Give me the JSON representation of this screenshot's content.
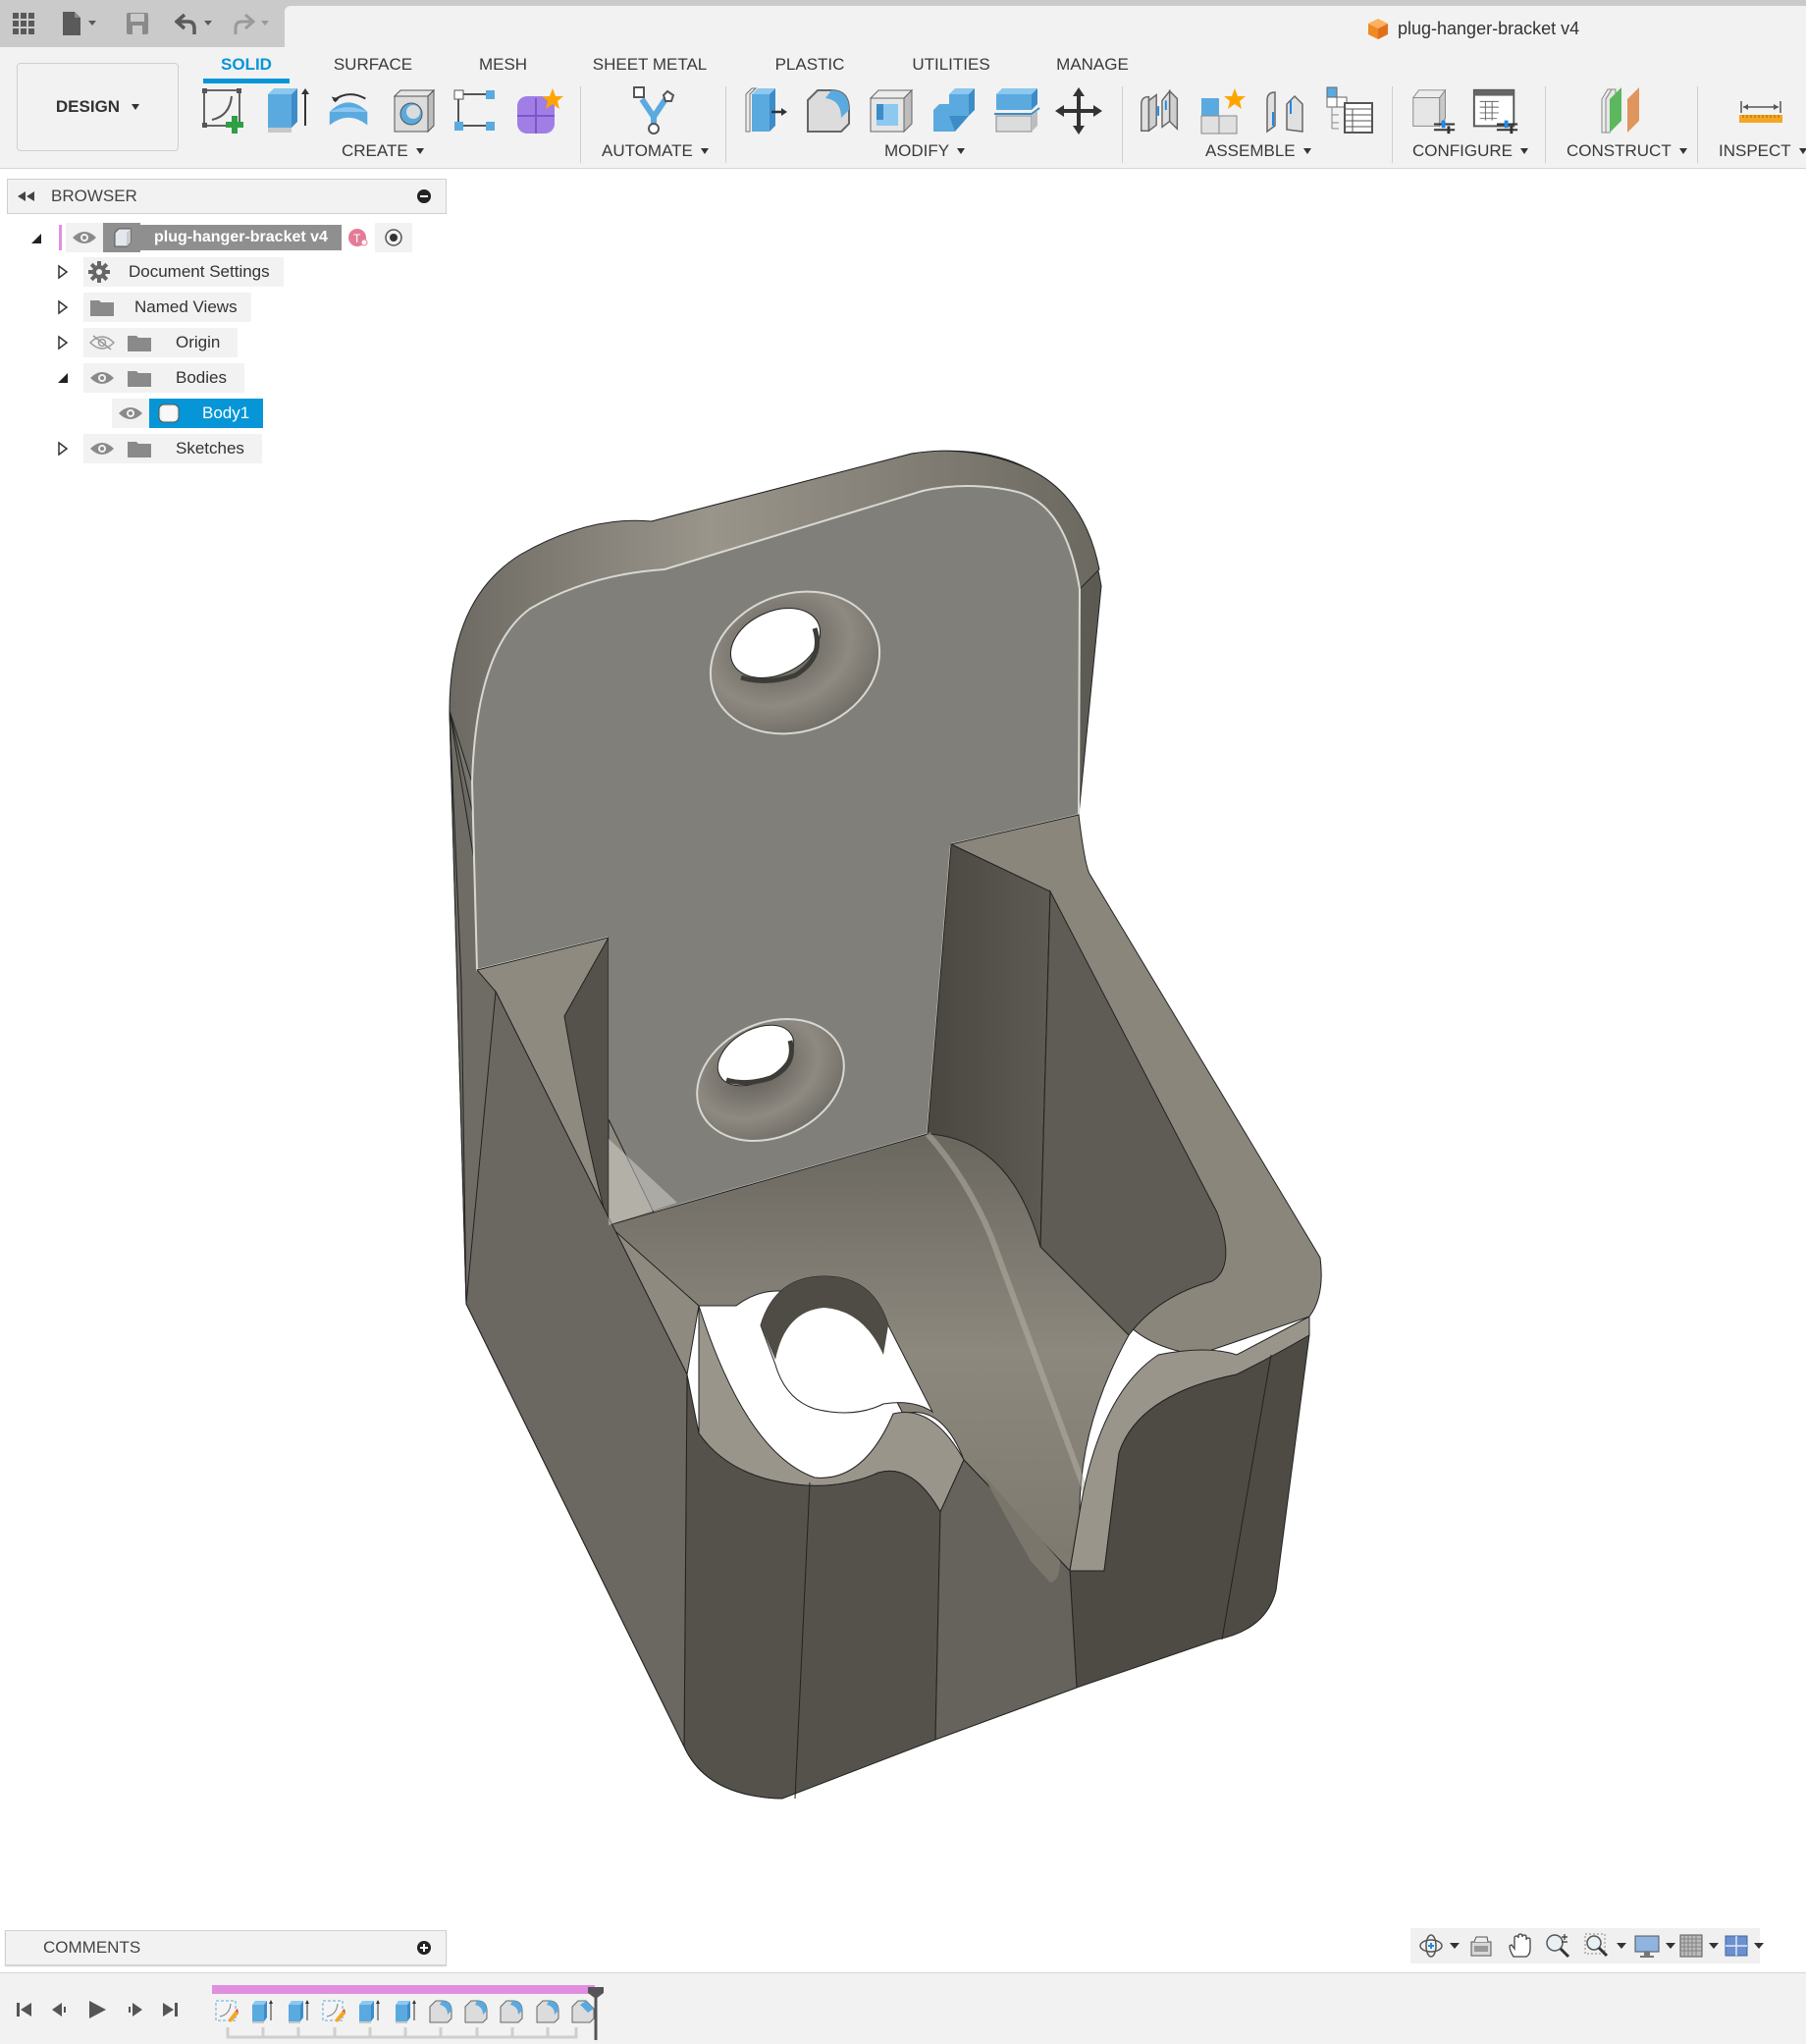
{
  "app": {
    "document_title": "plug-hanger-bracket v4",
    "colors": {
      "accent": "#0696d7",
      "selection": "#0696d7",
      "timeline_bar": "#e08fe0",
      "model_face": "#807f79",
      "model_dark": "#4e4b45"
    }
  },
  "quick_access": {
    "items": [
      {
        "name": "app-grid",
        "icon": "grid-icon"
      },
      {
        "name": "file-menu",
        "icon": "file-icon"
      },
      {
        "name": "save",
        "icon": "save-icon"
      },
      {
        "name": "undo",
        "icon": "undo-icon"
      },
      {
        "name": "redo",
        "icon": "redo-icon"
      }
    ]
  },
  "toolbar": {
    "workspace_label": "DESIGN",
    "tabs": [
      {
        "label": "SOLID",
        "active": true
      },
      {
        "label": "SURFACE",
        "active": false
      },
      {
        "label": "MESH",
        "active": false
      },
      {
        "label": "SHEET METAL",
        "active": false
      },
      {
        "label": "PLASTIC",
        "active": false
      },
      {
        "label": "UTILITIES",
        "active": false
      },
      {
        "label": "MANAGE",
        "active": false
      }
    ],
    "groups": [
      {
        "label": "CREATE",
        "tools": [
          "create-sketch",
          "extrude",
          "revolve",
          "hole",
          "pattern",
          "create-form"
        ]
      },
      {
        "label": "AUTOMATE",
        "tools": [
          "automate"
        ]
      },
      {
        "label": "MODIFY",
        "tools": [
          "press-pull",
          "fillet",
          "shell",
          "combine",
          "offset-face",
          "move-copy"
        ]
      },
      {
        "label": "ASSEMBLE",
        "tools": [
          "joint",
          "new-component",
          "as-built-joint",
          "joint-origin-table"
        ]
      },
      {
        "label": "CONFIGURE",
        "tools": [
          "configure-model",
          "configuration-table"
        ]
      },
      {
        "label": "CONSTRUCT",
        "tools": [
          "offset-plane"
        ]
      },
      {
        "label": "INSPECT",
        "tools": [
          "measure"
        ]
      }
    ]
  },
  "browser": {
    "title": "BROWSER",
    "root": {
      "label": "plug-hanger-bracket v4",
      "expanded": true
    },
    "items": [
      {
        "label": "Document Settings",
        "icon": "gear-icon",
        "expanded": false,
        "visible": null
      },
      {
        "label": "Named Views",
        "icon": "folder-icon",
        "expanded": false,
        "visible": null
      },
      {
        "label": "Origin",
        "icon": "folder-icon",
        "expanded": false,
        "visible": false
      },
      {
        "label": "Bodies",
        "icon": "folder-icon",
        "expanded": true,
        "visible": true
      },
      {
        "label": "Body1",
        "icon": "body-icon",
        "selected": true,
        "visible": true,
        "child": true
      },
      {
        "label": "Sketches",
        "icon": "folder-icon",
        "expanded": false,
        "visible": true
      }
    ]
  },
  "comments": {
    "title": "COMMENTS"
  },
  "timeline": {
    "controls": [
      "go-to-start",
      "step-back",
      "play",
      "step-forward",
      "go-to-end"
    ],
    "features": [
      "sketch",
      "extrude",
      "extrude",
      "sketch",
      "extrude",
      "extrude",
      "fillet",
      "fillet",
      "fillet",
      "fillet",
      "chamfer"
    ]
  },
  "navbar": {
    "items": [
      "orbit",
      "look-at",
      "pan",
      "zoom",
      "fit",
      "display-settings",
      "grid-snaps",
      "viewports"
    ]
  }
}
